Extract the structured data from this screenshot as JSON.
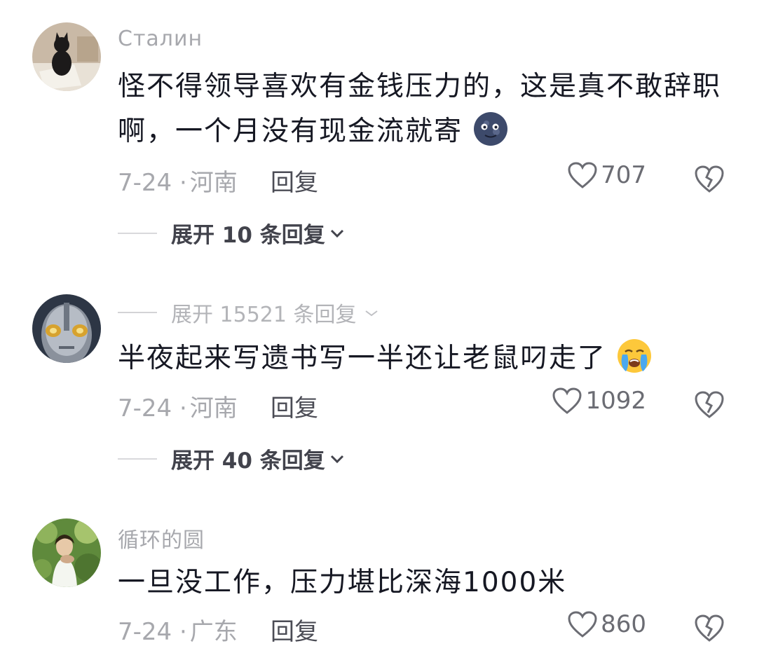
{
  "comments": [
    {
      "username": "Сталин",
      "text": "怪不得领导喜欢有金钱压力的，这是真不敢辞职啊，一个月没有现金流就寄",
      "emoji": "moon-face-emoji",
      "date": "7-24 ·",
      "location": "河南",
      "reply_label": "回复",
      "likes": "707",
      "expand_label": "展开 10 条回复"
    },
    {
      "username_line": "展开 15521 条回复",
      "text": "半夜起来写遗书写一半还让老鼠叼走了",
      "emoji": "crying-face-emoji",
      "date": "7-24 ·",
      "location": "河南",
      "reply_label": "回复",
      "likes": "1092",
      "expand_label": "展开 40 条回复"
    },
    {
      "username": "循环的圆",
      "text": "一旦没工作，压力堪比深海1000米",
      "date": "7-24 ·",
      "location": "广东",
      "reply_label": "回复",
      "likes": "860"
    }
  ],
  "icons": {
    "like": "heart-outline-icon",
    "dislike": "broken-heart-icon",
    "expand": "chevron-down-icon"
  },
  "colors": {
    "secondary_text": "#a7a8ad",
    "primary_text": "#161823"
  }
}
